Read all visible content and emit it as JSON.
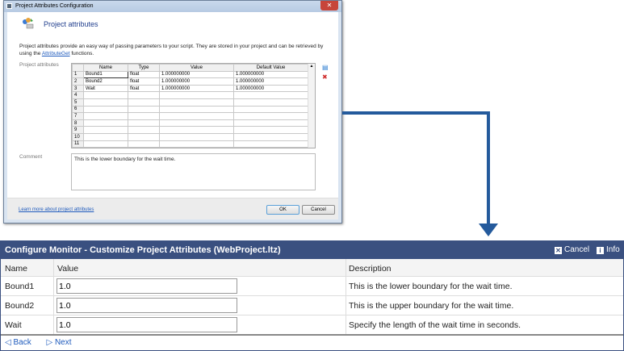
{
  "dialog": {
    "title": "Project Attributes Configuration",
    "header": "Project attributes",
    "description": "Project attributes provide an easy way of passing parameters to your script.  They are stored in your project and can be retrieved by using the",
    "description_link": "AttributeGet",
    "description_end": " functions.",
    "grid_label": "Project attributes",
    "columns": [
      "Name",
      "Type",
      "Value",
      "Default Value"
    ],
    "rows": [
      {
        "n": "1",
        "name": "Bound1",
        "type": "float",
        "value": "1.000000000",
        "default": "1.000000000"
      },
      {
        "n": "2",
        "name": "Bound2",
        "type": "float",
        "value": "1.000000000",
        "default": "1.000000000"
      },
      {
        "n": "3",
        "name": "Wait",
        "type": "float",
        "value": "1.000000000",
        "default": "1.000000000"
      },
      {
        "n": "4"
      },
      {
        "n": "5"
      },
      {
        "n": "6"
      },
      {
        "n": "7"
      },
      {
        "n": "8"
      },
      {
        "n": "9"
      },
      {
        "n": "10"
      },
      {
        "n": "11"
      }
    ],
    "comment_label": "Comment",
    "comment": "This is the lower boundary for the wait time.",
    "learn_more": "Learn more about project attributes",
    "ok": "OK",
    "cancel": "Cancel"
  },
  "panel": {
    "title": "Configure Monitor - Customize Project Attributes (WebProject.ltz)",
    "cancel": "Cancel",
    "info": "Info",
    "columns": [
      "Name",
      "Value",
      "Description"
    ],
    "rows": [
      {
        "name": "Bound1",
        "value": "1.0",
        "description": "This is the lower boundary for the wait time."
      },
      {
        "name": "Bound2",
        "value": "1.0",
        "description": "This is the upper boundary for the wait time."
      },
      {
        "name": "Wait",
        "value": "1.0",
        "description": "Specify the length of the wait time in seconds."
      }
    ],
    "back": "Back",
    "next": "Next"
  }
}
